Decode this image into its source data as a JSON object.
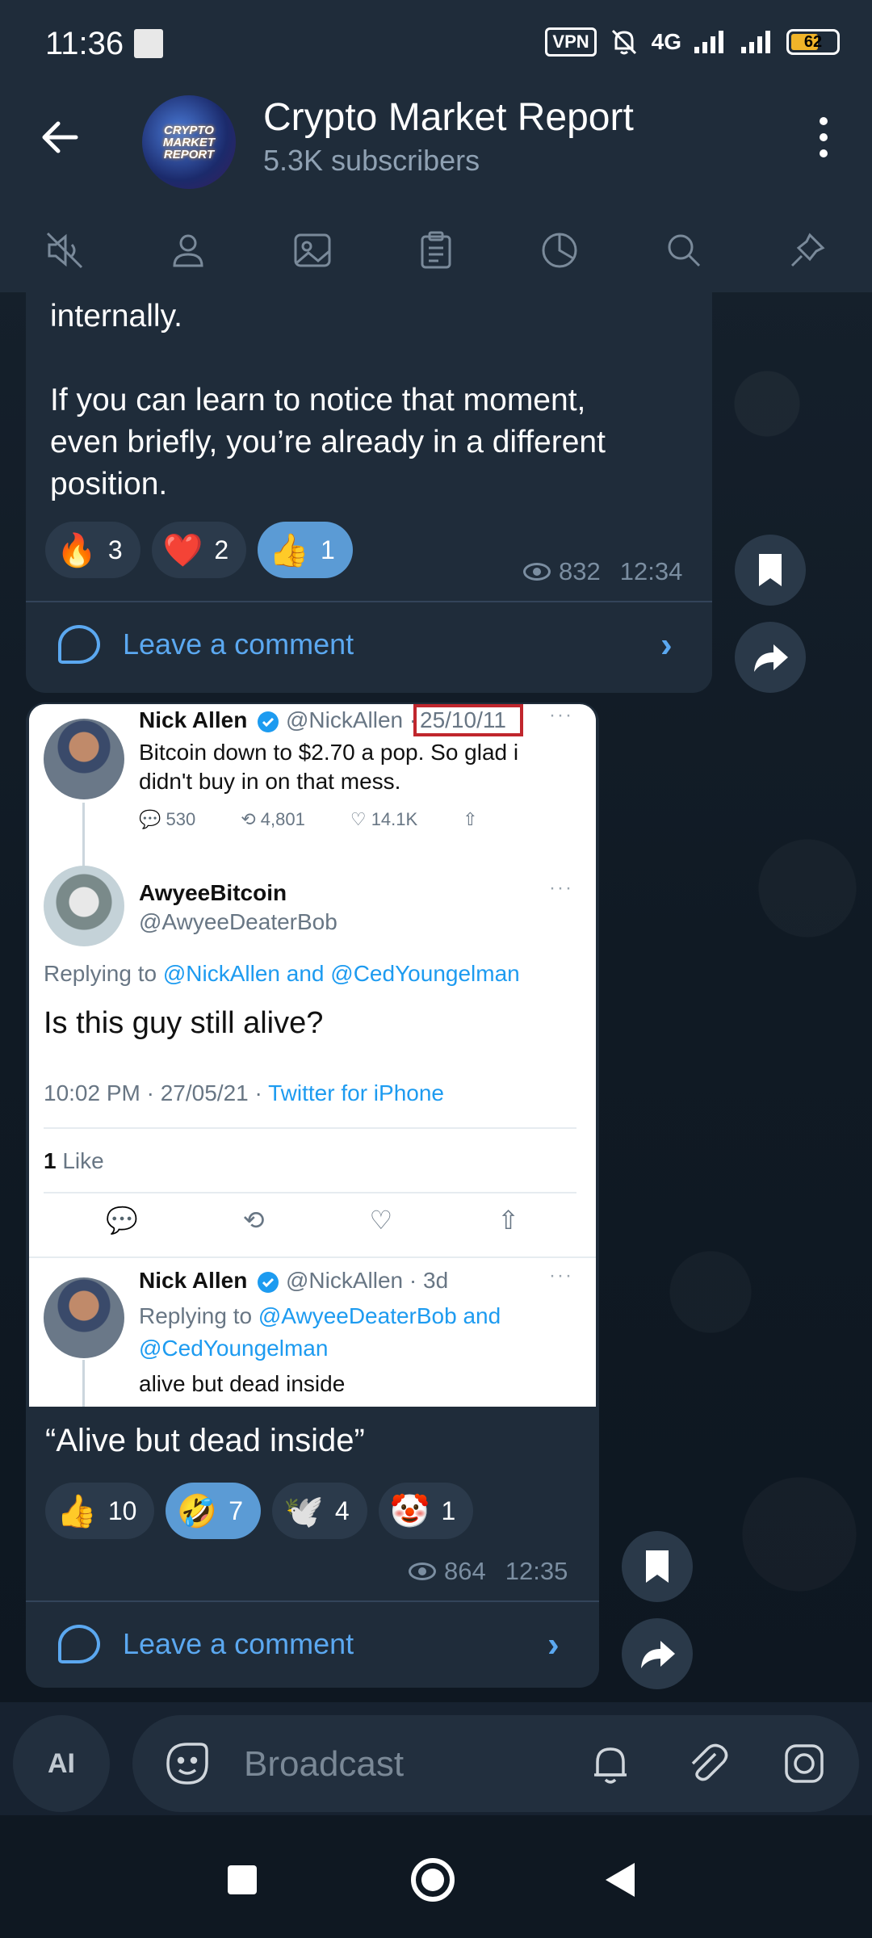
{
  "status": {
    "time": "11:36",
    "vpn": "VPN",
    "network": "4G",
    "battery": "62"
  },
  "header": {
    "title": "Crypto Market Report",
    "subtitle": "5.3K subscribers",
    "avatar_text": "CRYPTO MARKET REPORT"
  },
  "tabs": [
    "muted-speaker-icon",
    "person-icon",
    "image-icon",
    "clipboard-icon",
    "pie-chart-icon",
    "search-icon",
    "pin-icon"
  ],
  "messages": [
    {
      "text_lines": [
        "internally.",
        "",
        "If you can learn to notice that moment,",
        "even briefly, you’re already in a different",
        "position."
      ],
      "reactions": [
        {
          "emoji": "🔥",
          "count": "3"
        },
        {
          "emoji": "❤️",
          "count": "2"
        },
        {
          "emoji": "👍",
          "count": "1"
        }
      ],
      "views": "832",
      "time": "12:34",
      "comment_label": "Leave a comment"
    },
    {
      "caption": "“Alive but dead inside”",
      "reactions": [
        {
          "emoji": "👍",
          "count": "10"
        },
        {
          "emoji": "🤣",
          "count": "7"
        },
        {
          "emoji": "🕊️",
          "count": "4"
        },
        {
          "emoji": "🤡",
          "count": "1"
        }
      ],
      "views": "864",
      "time": "12:35",
      "comment_label": "Leave a comment"
    }
  ],
  "tweet": {
    "t1_name": "Nick Allen",
    "t1_handle": "@NickAllen ·",
    "t1_date": "25/10/11",
    "t1_text_1": "Bitcoin down to $2.70 a pop. So glad i",
    "t1_text_2": "didn't buy in on that mess.",
    "t1_replies": "530",
    "t1_retweets": "4,801",
    "t1_likes": "14.1K",
    "t2_name": "AwyeeBitcoin",
    "t2_handle": "@AwyeeDeaterBob",
    "t2_replying": "Replying to",
    "t2_mentions": "@NickAllen and @CedYoungelman",
    "t2_text": "Is this guy still alive?",
    "t2_time": "10:02 PM · 27/05/21 ·",
    "t2_source": "Twitter for iPhone",
    "t2_likes_num": "1",
    "t2_likes_label": "Like",
    "t3_name": "Nick Allen",
    "t3_handle": "@NickAllen · 3d",
    "t3_replying": "Replying to",
    "t3_mention_1": "@AwyeeDeaterBob and",
    "t3_mention_2": "@CedYoungelman",
    "t3_text": "alive but dead inside"
  },
  "input": {
    "ai_label": "AI",
    "placeholder": "Broadcast"
  }
}
